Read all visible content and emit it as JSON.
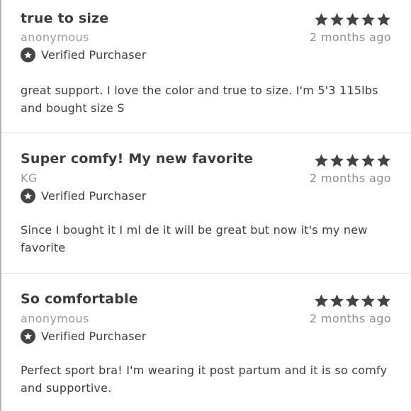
{
  "reviews": [
    {
      "title": "true to size",
      "author": "anonymous",
      "verified_label": "Verified Purchaser",
      "rating": 5,
      "date": "2 months ago",
      "body": "great support. I love the color and true to size. I'm 5'3 115lbs and bought size S"
    },
    {
      "title": "Super comfy! My new favorite",
      "author": "KG",
      "verified_label": "Verified Purchaser",
      "rating": 5,
      "date": "2 months ago",
      "body": "Since I bought it I ml de it will be great but now it's my new favorite"
    },
    {
      "title": "So comfortable",
      "author": "anonymous",
      "verified_label": "Verified Purchaser",
      "rating": 5,
      "date": "2 months ago",
      "body": "Perfect sport bra! I'm wearing it post partum and it is so comfy and supportive."
    }
  ],
  "colors": {
    "star": "#444444",
    "verified_badge": "#444444",
    "muted_text": "#9a9a9a"
  }
}
